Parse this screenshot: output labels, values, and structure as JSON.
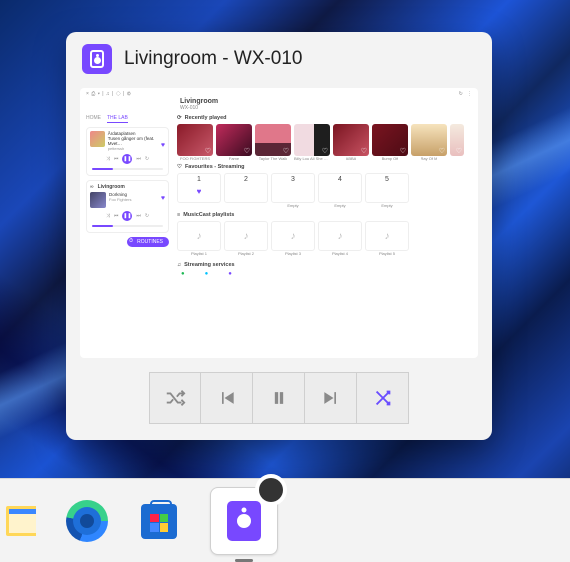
{
  "window": {
    "title": "Livingroom - WX-010"
  },
  "thumb": {
    "room_title": "Livingroom",
    "room_model": "WX-010",
    "tabs": {
      "home": "HOME",
      "lab": "THE LAB"
    },
    "nowplaying1": {
      "album": "Årdataplatsen",
      "song": "Tusen gånger om (feat. Mvet…",
      "artist": "petterssh"
    },
    "roombox": {
      "link_icon": "∞",
      "name": "Livingroom",
      "song": "Dorkning",
      "artist": "Foo Fighters"
    },
    "routines_label": "ROUTINES",
    "sections": {
      "recent": "Recently played",
      "favs": "Favourites - Streaming",
      "playlists": "MusicCast playlists",
      "services": "Streaming services"
    },
    "recent": [
      {
        "t": "FOO FIGHTERS"
      },
      {
        "t": "Fame"
      },
      {
        "t": "Taylor The Walk"
      },
      {
        "t": "Billy Lou All She Want (Remix orig…"
      },
      {
        "t": "ABBA"
      },
      {
        "t": "Bump Off"
      },
      {
        "t": "Ray Of M"
      },
      {
        "t": ""
      }
    ],
    "favs": [
      {
        "n": "1",
        "lbl": "",
        "heart": true
      },
      {
        "n": "2",
        "lbl": "",
        "heart": false
      },
      {
        "n": "3",
        "lbl": "Empty",
        "heart": false
      },
      {
        "n": "4",
        "lbl": "Empty",
        "heart": false
      },
      {
        "n": "5",
        "lbl": "Empty",
        "heart": false
      }
    ],
    "playlists": [
      {
        "lbl": "Playlist 1"
      },
      {
        "lbl": "Playlist 2"
      },
      {
        "lbl": "Playlist 3"
      },
      {
        "lbl": "Playlist 4"
      },
      {
        "lbl": "Playlist 5"
      }
    ]
  },
  "transport": {
    "shuffle": "Shuffle",
    "prev": "Previous",
    "pause": "Pause",
    "next": "Next",
    "cross": "Crossfade"
  }
}
